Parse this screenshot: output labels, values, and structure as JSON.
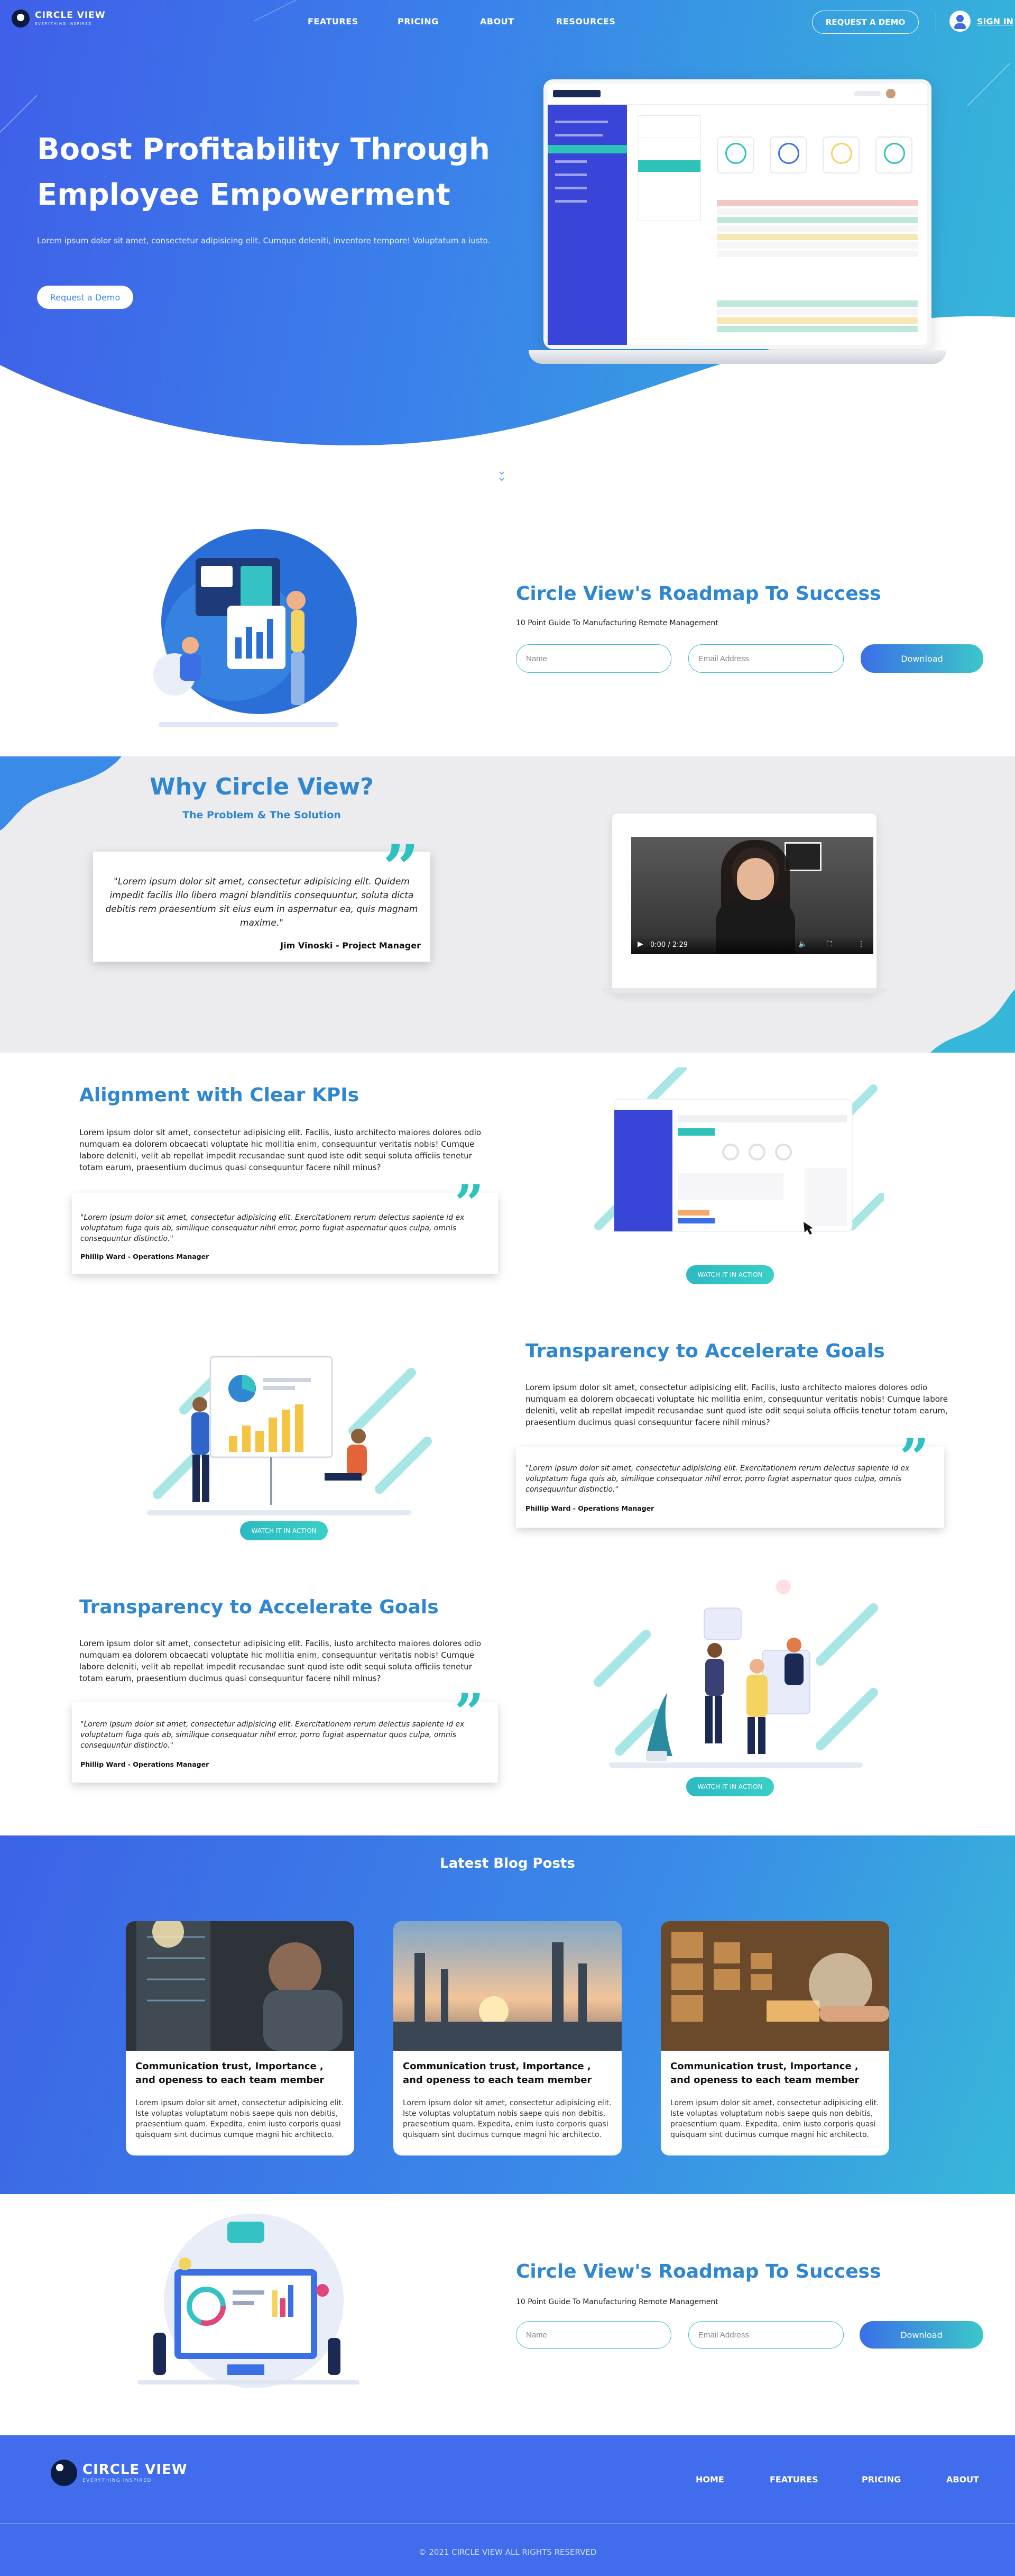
{
  "brand": {
    "name": "CIRCLE VIEW",
    "tagline": "EVERYTHING INSPIRED"
  },
  "nav": {
    "items": [
      "FEATURES",
      "PRICING",
      "ABOUT",
      "RESOURCES"
    ],
    "cta": "REQUEST A DEMO",
    "signin": "SIGN IN"
  },
  "hero": {
    "title_line1": "Boost Profitability Through",
    "title_line2": "Employee Empowerment",
    "subtitle": "Lorem ipsum dolor sit amet, consectetur adipisicing elit. Cumque deleniti, inventore tempore! Voluptatum a iusto.",
    "button": "Request a Demo"
  },
  "roadmap": {
    "title": "Circle View's Roadmap To Success",
    "subtitle": "10 Point Guide To Manufacturing Remote Management",
    "name_placeholder": "Name",
    "email_placeholder": "Email Address",
    "button": "Download"
  },
  "why": {
    "title": "Why Circle View?",
    "subtitle": "The Problem & The Solution",
    "quote": "\"Lorem ipsum dolor sit amet, consectetur adipisicing elit. Quidem impedit facilis illo libero magni blanditiis consequuntur, soluta dicta debitis rem praesentium sit eius eum in aspernatur ea, quis magnam maxime.\"",
    "author": "Jim Vinoski - Project Manager",
    "video_time": "0:00 / 2:29"
  },
  "features": [
    {
      "title": "Alignment with Clear KPIs",
      "body": "Lorem ipsum dolor sit amet, consectetur adipisicing elit. Facilis, iusto architecto maiores dolores odio numquam ea dolorem obcaecati voluptate hic mollitia enim, consequuntur veritatis nobis! Cumque labore deleniti, velit ab repellat impedit recusandae sunt quod iste odit sequi soluta officiis tenetur totam earum, praesentium ducimus quasi consequuntur facere nihil minus?",
      "quote": "\"Lorem ipsum dolor sit amet, consectetur adipisicing elit. Exercitationem rerum delectus sapiente id ex voluptatum fuga quis ab, similique consequatur nihil error, porro fugiat aspernatur quos culpa, omnis consequuntur distinctio.\"",
      "author": "Phillip Ward - Operations Manager",
      "watch": "WATCH IT IN ACTION"
    },
    {
      "title": "Transparency to Accelerate Goals",
      "body": "Lorem ipsum dolor sit amet, consectetur adipisicing elit. Facilis, iusto architecto maiores dolores odio numquam ea dolorem obcaecati voluptate hic mollitia enim, consequuntur veritatis nobis! Cumque labore deleniti, velit ab repellat impedit recusandae sunt quod iste odit sequi soluta officiis tenetur totam earum, praesentium ducimus quasi consequuntur facere nihil minus?",
      "quote": "\"Lorem ipsum dolor sit amet, consectetur adipisicing elit. Exercitationem rerum delectus sapiente id ex voluptatum fuga quis ab, similique consequatur nihil error, porro fugiat aspernatur quos culpa, omnis consequuntur distinctio.\"",
      "author": "Phillip Ward - Operations Manager",
      "watch": "WATCH IT IN ACTION"
    },
    {
      "title": "Transparency to Accelerate Goals",
      "body": "Lorem ipsum dolor sit amet, consectetur adipisicing elit. Facilis, iusto architecto maiores dolores odio numquam ea dolorem obcaecati voluptate hic mollitia enim, consequuntur veritatis nobis! Cumque labore deleniti, velit ab repellat impedit recusandae sunt quod iste odit sequi soluta officiis tenetur totam earum, praesentium ducimus quasi consequuntur facere nihil minus?",
      "quote": "\"Lorem ipsum dolor sit amet, consectetur adipisicing elit. Exercitationem rerum delectus sapiente id ex voluptatum fuga quis ab, similique consequatur nihil error, porro fugiat aspernatur quos culpa, omnis consequuntur distinctio.\"",
      "author": "Phillip Ward - Operations Manager",
      "watch": "WATCH IT IN ACTION"
    }
  ],
  "blog": {
    "title": "Latest Blog Posts",
    "posts": [
      {
        "title": "Communication trust, Importance , and openess to each team member",
        "text": "Lorem ipsum dolor sit amet, consectetur adipisicing elit. Iste voluptas voluptatum nobis saepe quis non debitis, praesentium quam. Expedita, enim iusto corporis quasi quisquam sint ducimus cumque magni hic architecto."
      },
      {
        "title": "Communication trust, Importance , and openess to each team member",
        "text": "Lorem ipsum dolor sit amet, consectetur adipisicing elit. Iste voluptas voluptatum nobis saepe quis non debitis, praesentium quam. Expedita, enim iusto corporis quasi quisquam sint ducimus cumque magni hic architecto."
      },
      {
        "title": "Communication trust, Importance , and openess to each team member",
        "text": "Lorem ipsum dolor sit amet, consectetur adipisicing elit. Iste voluptas voluptatum nobis saepe quis non debitis, praesentium quam. Expedita, enim iusto corporis quasi quisquam sint ducimus cumque magni hic architecto."
      }
    ]
  },
  "roadmap2": {
    "title": "Circle View's Roadmap To Success",
    "subtitle": "10 Point Guide To Manufacturing Remote Management",
    "name_placeholder": "Name",
    "email_placeholder": "Email Address",
    "button": "Download"
  },
  "footer": {
    "links": [
      "HOME",
      "FEATURES",
      "PRICING",
      "ABOUT"
    ],
    "copyright": "© 2021 CIRCLE VIEW ALL RIGHTS RESERVED"
  },
  "colors": {
    "primary": "#3d6be6",
    "accent": "#35c2c4",
    "heading": "#2f86d1",
    "footer": "#416ceb"
  }
}
